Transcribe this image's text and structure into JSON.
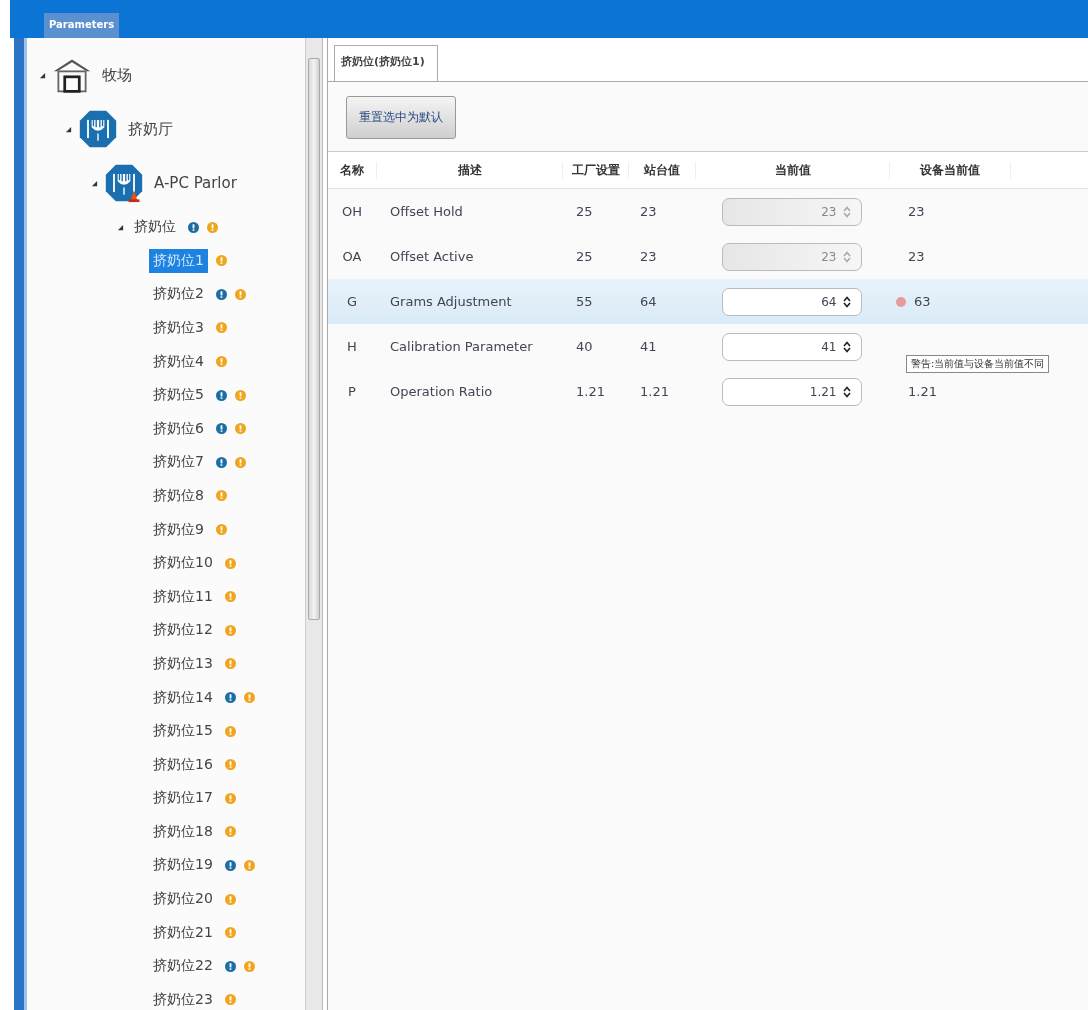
{
  "window": {
    "title": "Parameters"
  },
  "tree": [
    {
      "label": "牧场",
      "kind": "farm",
      "expanded": true,
      "selected": false,
      "children": [
        {
          "label": "挤奶厅",
          "kind": "parlor",
          "expanded": true,
          "selected": false,
          "children": [
            {
              "label": "A-PC Parlor",
              "kind": "parlor_alert",
              "expanded": true,
              "selected": false,
              "children": [
                {
                  "label": "挤奶位",
                  "kind": "group",
                  "expanded": true,
                  "selected": false,
                  "info": true,
                  "warning": true,
                  "children": [
                    {
                      "label": "挤奶位1",
                      "kind": "stall",
                      "selected": true,
                      "info": false,
                      "warning": true
                    },
                    {
                      "label": "挤奶位2",
                      "kind": "stall",
                      "selected": false,
                      "info": true,
                      "warning": true
                    },
                    {
                      "label": "挤奶位3",
                      "kind": "stall",
                      "selected": false,
                      "info": false,
                      "warning": true
                    },
                    {
                      "label": "挤奶位4",
                      "kind": "stall",
                      "selected": false,
                      "info": false,
                      "warning": true
                    },
                    {
                      "label": "挤奶位5",
                      "kind": "stall",
                      "selected": false,
                      "info": true,
                      "warning": true
                    },
                    {
                      "label": "挤奶位6",
                      "kind": "stall",
                      "selected": false,
                      "info": true,
                      "warning": true
                    },
                    {
                      "label": "挤奶位7",
                      "kind": "stall",
                      "selected": false,
                      "info": true,
                      "warning": true
                    },
                    {
                      "label": "挤奶位8",
                      "kind": "stall",
                      "selected": false,
                      "info": false,
                      "warning": true
                    },
                    {
                      "label": "挤奶位9",
                      "kind": "stall",
                      "selected": false,
                      "info": false,
                      "warning": true
                    },
                    {
                      "label": "挤奶位10",
                      "kind": "stall",
                      "selected": false,
                      "info": false,
                      "warning": true
                    },
                    {
                      "label": "挤奶位11",
                      "kind": "stall",
                      "selected": false,
                      "info": false,
                      "warning": true
                    },
                    {
                      "label": "挤奶位12",
                      "kind": "stall",
                      "selected": false,
                      "info": false,
                      "warning": true
                    },
                    {
                      "label": "挤奶位13",
                      "kind": "stall",
                      "selected": false,
                      "info": false,
                      "warning": true
                    },
                    {
                      "label": "挤奶位14",
                      "kind": "stall",
                      "selected": false,
                      "info": true,
                      "warning": true
                    },
                    {
                      "label": "挤奶位15",
                      "kind": "stall",
                      "selected": false,
                      "info": false,
                      "warning": true
                    },
                    {
                      "label": "挤奶位16",
                      "kind": "stall",
                      "selected": false,
                      "info": false,
                      "warning": true
                    },
                    {
                      "label": "挤奶位17",
                      "kind": "stall",
                      "selected": false,
                      "info": false,
                      "warning": true
                    },
                    {
                      "label": "挤奶位18",
                      "kind": "stall",
                      "selected": false,
                      "info": false,
                      "warning": true
                    },
                    {
                      "label": "挤奶位19",
                      "kind": "stall",
                      "selected": false,
                      "info": true,
                      "warning": true
                    },
                    {
                      "label": "挤奶位20",
                      "kind": "stall",
                      "selected": false,
                      "info": false,
                      "warning": true
                    },
                    {
                      "label": "挤奶位21",
                      "kind": "stall",
                      "selected": false,
                      "info": false,
                      "warning": true
                    },
                    {
                      "label": "挤奶位22",
                      "kind": "stall",
                      "selected": false,
                      "info": true,
                      "warning": true
                    },
                    {
                      "label": "挤奶位23",
                      "kind": "stall",
                      "selected": false,
                      "info": false,
                      "warning": true
                    }
                  ]
                }
              ]
            }
          ]
        }
      ]
    }
  ],
  "tabs": [
    {
      "label": "挤奶位(挤奶位1)",
      "selected": true
    }
  ],
  "reset_button": "重置选中为默认",
  "table": {
    "columns": [
      "名称",
      "描述",
      "工厂设置",
      "站台值",
      "当前值",
      "设备当前值"
    ],
    "rows": [
      {
        "name": "OH",
        "description": "Offset Hold",
        "factory": "25",
        "station": "23",
        "current": "23",
        "device": "23",
        "selected": false,
        "disabled": true,
        "warning": false
      },
      {
        "name": "OA",
        "description": "Offset Active",
        "factory": "25",
        "station": "23",
        "current": "23",
        "device": "23",
        "selected": false,
        "disabled": true,
        "warning": false
      },
      {
        "name": "G",
        "description": "Grams Adjustment",
        "factory": "55",
        "station": "64",
        "current": "64",
        "device": "63",
        "selected": true,
        "disabled": false,
        "warning": true
      },
      {
        "name": "H",
        "description": "Calibration Parameter",
        "factory": "40",
        "station": "41",
        "current": "41",
        "selected": false,
        "disabled": false,
        "warning": false
      },
      {
        "name": "P",
        "description": "Operation Ratio",
        "factory": "1.21",
        "station": "1.21",
        "current": "1.21",
        "device": "1.21",
        "selected": false,
        "disabled": false,
        "warning": false
      }
    ]
  },
  "tooltip": {
    "text": "警告:当前值与设备当前值不同"
  }
}
